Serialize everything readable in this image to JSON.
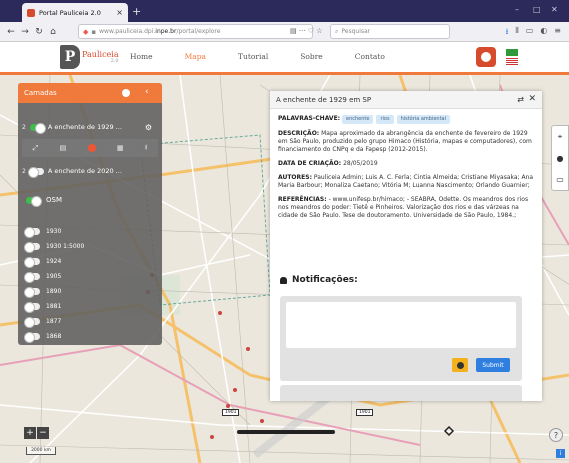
{
  "browser": {
    "tab_title": "Portal Pauliceia 2.0",
    "url_prefix": "www.pauliceia.dpi.",
    "url_host": "inpe.br",
    "url_path": "/portal/explore",
    "search_placeholder": "Pesquisar"
  },
  "site": {
    "logo_name": "Pauliceia",
    "logo_version": "2.0",
    "menu": [
      "Home",
      "Mapa",
      "Tutorial",
      "Sobre",
      "Contato"
    ],
    "active_menu": "Mapa"
  },
  "layers": {
    "title": "Camadas",
    "items": [
      {
        "num": "2",
        "label": "A enchente de 1929 ...",
        "on": true
      },
      {
        "num": "2",
        "label": "A enchente de 2020 ...",
        "on": false
      }
    ],
    "base_label": "OSM",
    "years": [
      "1930",
      "1930 1:5000",
      "1924",
      "1905",
      "1890",
      "1881",
      "1877",
      "1868"
    ]
  },
  "info": {
    "title": "A enchente de 1929 em SP",
    "keywords_label": "PALAVRAS-CHAVE:",
    "keywords": [
      "enchente",
      "rios",
      "história ambiental"
    ],
    "description_label": "DESCRIÇÃO:",
    "description": "Mapa aproximado da abrangência da enchente de fevereiro de 1929 em São Paulo, produzido pelo grupo Himaco (História, mapas e computadores), com financiamento do CNPq e da Fapesp (2012-2015).",
    "created_label": "DATA DE CRIAÇÃO:",
    "created": "28/05/2019",
    "authors_label": "AUTORES:",
    "authors": "Pauliceia Admin; Luis A. C. Ferla; Cintia Almeida; Cristiane Miyasaka; Ana Maria Barbour; Monaliza Caetano; Vitória M; Luanna Nascimento; Orlando Guarnier;",
    "refs_label": "REFERÊNCIAS:",
    "refs": "- www.unifesp.br/himaco; - SEABRA, Odette. Os meandros dos rios nos meandros do poder: Tietê e Pinheiros. Valorização dos rios e das várzeas na cidade de São Paulo. Tese de doutoramento. Universidade de São Paulo, 1984.;",
    "notifications_label": "Notificações:",
    "submit_label": "Submit"
  },
  "map": {
    "scale_label": "2000 km",
    "labels": [
      "1901",
      "1901"
    ]
  }
}
